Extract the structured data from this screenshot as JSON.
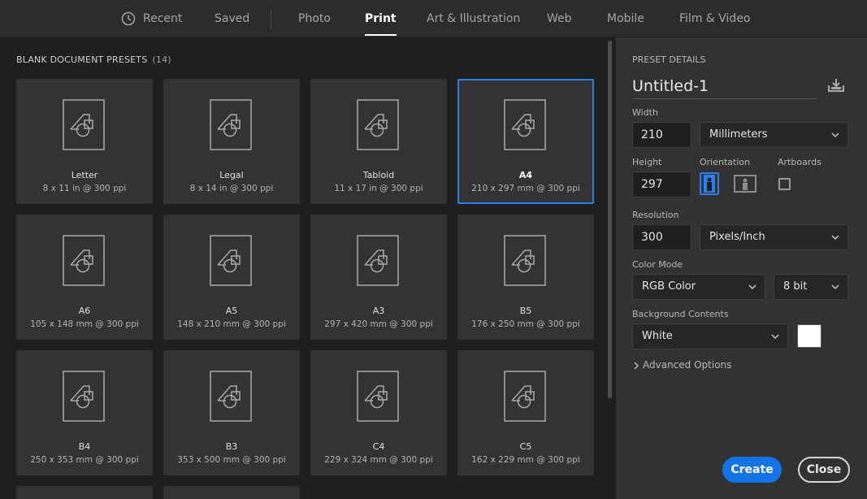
{
  "tabs": {
    "recent": "Recent",
    "saved": "Saved",
    "photo": "Photo",
    "print": "Print",
    "art": "Art & Illustration",
    "web": "Web",
    "mobile": "Mobile",
    "film": "Film & Video",
    "active": "Print"
  },
  "presets": {
    "heading": "BLANK DOCUMENT PRESETS",
    "count": "(14)",
    "items": [
      {
        "name": "Letter",
        "dims": "8 x 11 in @ 300 ppi"
      },
      {
        "name": "Legal",
        "dims": "8 x 14 in @ 300 ppi"
      },
      {
        "name": "Tabloid",
        "dims": "11 x 17 in @ 300 ppi"
      },
      {
        "name": "A4",
        "dims": "210 x 297 mm @ 300 ppi"
      },
      {
        "name": "A6",
        "dims": "105 x 148 mm @ 300 ppi"
      },
      {
        "name": "A5",
        "dims": "148 x 210 mm @ 300 ppi"
      },
      {
        "name": "A3",
        "dims": "297 x 420 mm @ 300 ppi"
      },
      {
        "name": "B5",
        "dims": "176 x 250 mm @ 300 ppi"
      },
      {
        "name": "B4",
        "dims": "250 x 353 mm @ 300 ppi"
      },
      {
        "name": "B3",
        "dims": "353 x 500 mm @ 300 ppi"
      },
      {
        "name": "C4",
        "dims": "229 x 324 mm @ 300 ppi"
      },
      {
        "name": "C5",
        "dims": "162 x 229 mm @ 300 ppi"
      }
    ],
    "selected": "A4"
  },
  "details": {
    "heading": "PRESET DETAILS",
    "title": "Untitled-1",
    "width_label": "Width",
    "width_value": "210",
    "width_unit": "Millimeters",
    "height_label": "Height",
    "height_value": "297",
    "orientation_label": "Orientation",
    "orientation_selected": "portrait",
    "artboards_label": "Artboards",
    "artboards_checked": false,
    "resolution_label": "Resolution",
    "resolution_value": "300",
    "resolution_unit": "Pixels/Inch",
    "color_mode_label": "Color Mode",
    "color_mode": "RGB Color",
    "bit_depth": "8 bit",
    "background_label": "Background Contents",
    "background": "White",
    "background_swatch": "#ffffff",
    "advanced": "Advanced Options"
  },
  "buttons": {
    "create": "Create",
    "close": "Close"
  },
  "colors": {
    "accent": "#1473e6",
    "selection": "#2b7ef0"
  }
}
